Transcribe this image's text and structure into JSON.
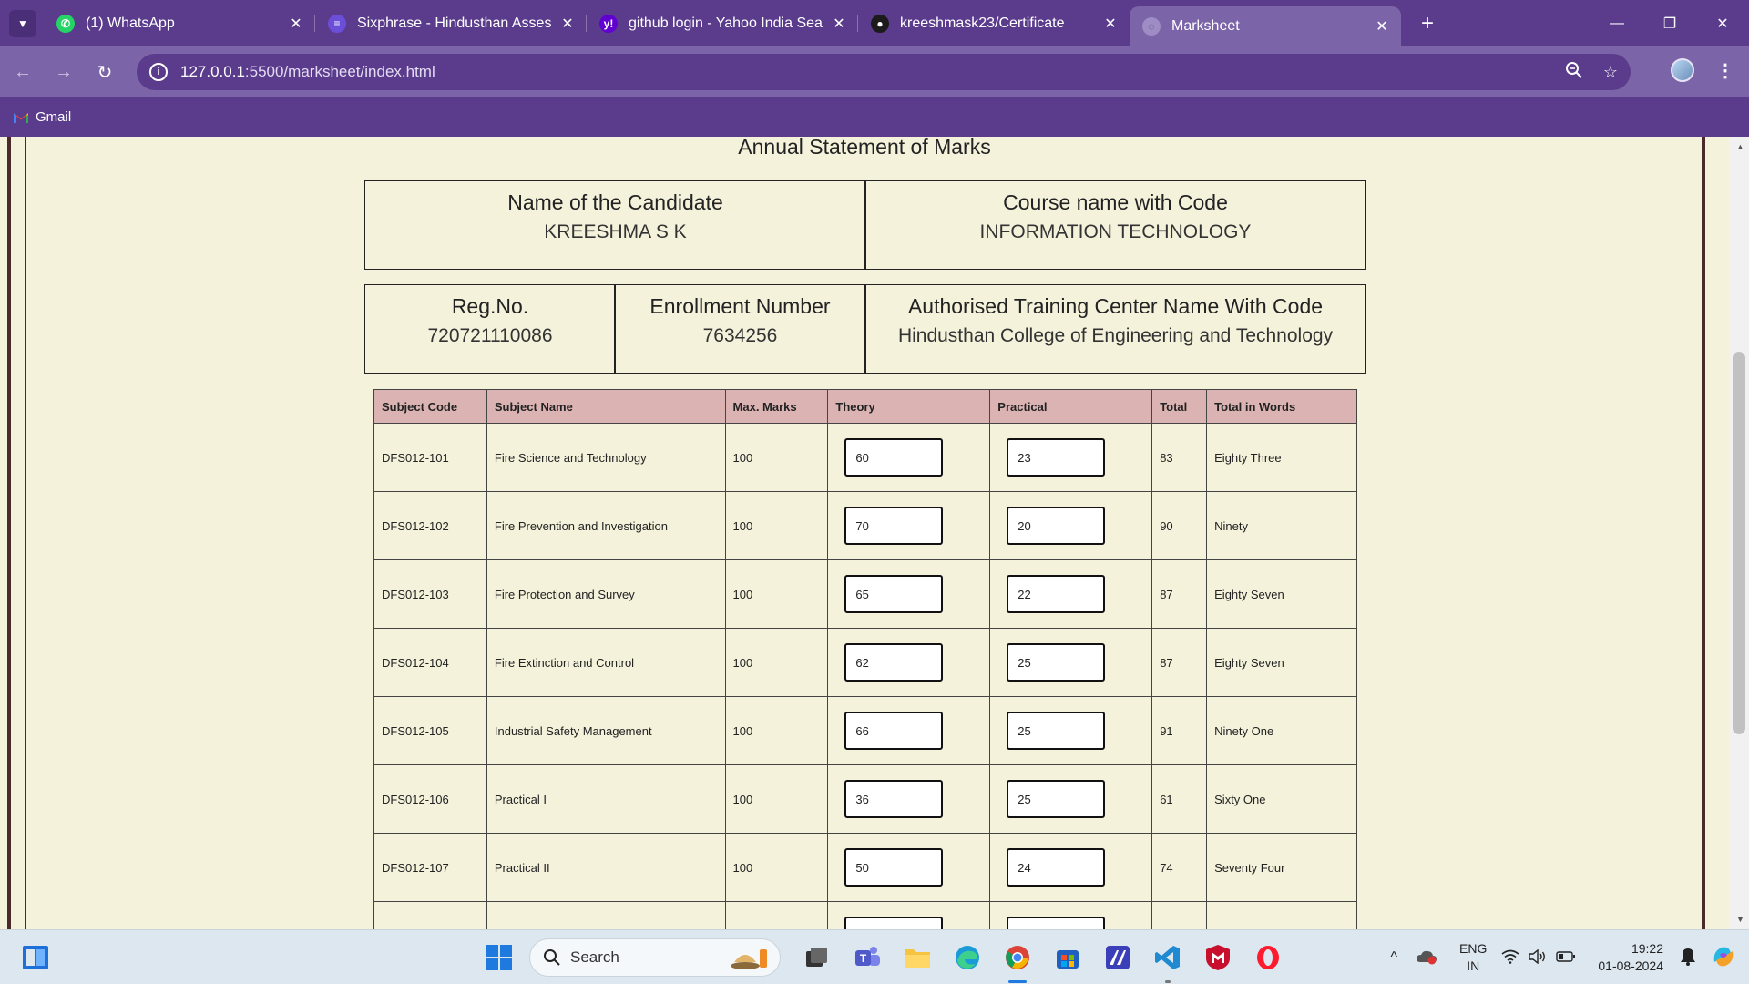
{
  "browser": {
    "tabs": [
      {
        "title": "(1) WhatsApp",
        "icon": "whatsapp-icon",
        "active": false
      },
      {
        "title": "Sixphrase - Hindusthan Assessm",
        "icon": "sixphrase-icon",
        "active": false
      },
      {
        "title": "github login - Yahoo India Sear",
        "icon": "yahoo-icon",
        "active": false
      },
      {
        "title": "kreeshmask23/Certificate",
        "icon": "github-icon",
        "active": false
      },
      {
        "title": "Marksheet",
        "icon": "globe-icon",
        "active": true
      }
    ],
    "url_host": "127.0.0.1",
    "url_path": ":5500/marksheet/index.html",
    "bookmark": "Gmail"
  },
  "page": {
    "title": "Annual Statement of Marks",
    "candidate_label": "Name of the Candidate",
    "candidate_value": "KREESHMA S K",
    "course_label": "Course name with Code",
    "course_value": "INFORMATION TECHNOLOGY",
    "reg_label": "Reg.No.",
    "reg_value": "720721110086",
    "enroll_label": "Enrollment Number",
    "enroll_value": "7634256",
    "center_label": "Authorised Training Center Name With Code",
    "center_value": "Hindusthan College of Engineering and Technology",
    "table": {
      "headers": [
        "Subject Code",
        "Subject Name",
        "Max. Marks",
        "Theory",
        "Practical",
        "Total",
        "Total in Words"
      ],
      "rows": [
        {
          "code": "DFS012-101",
          "name": "Fire Science and Technology",
          "max": "100",
          "theory": "60",
          "practical": "23",
          "total": "83",
          "words": "Eighty Three"
        },
        {
          "code": "DFS012-102",
          "name": "Fire Prevention and Investigation",
          "max": "100",
          "theory": "70",
          "practical": "20",
          "total": "90",
          "words": "Ninety"
        },
        {
          "code": "DFS012-103",
          "name": "Fire Protection and Survey",
          "max": "100",
          "theory": "65",
          "practical": "22",
          "total": "87",
          "words": "Eighty Seven"
        },
        {
          "code": "DFS012-104",
          "name": "Fire Extinction and Control",
          "max": "100",
          "theory": "62",
          "practical": "25",
          "total": "87",
          "words": "Eighty Seven"
        },
        {
          "code": "DFS012-105",
          "name": "Industrial Safety Management",
          "max": "100",
          "theory": "66",
          "practical": "25",
          "total": "91",
          "words": "Ninety One"
        },
        {
          "code": "DFS012-106",
          "name": "Practical I",
          "max": "100",
          "theory": "36",
          "practical": "25",
          "total": "61",
          "words": "Sixty One"
        },
        {
          "code": "DFS012-107",
          "name": "Practical II",
          "max": "100",
          "theory": "50",
          "practical": "24",
          "total": "74",
          "words": "Seventy Four"
        },
        {
          "code": "",
          "name": "",
          "max": "",
          "theory": "",
          "practical": "",
          "total": "",
          "words": ""
        }
      ]
    }
  },
  "taskbar": {
    "search_placeholder": "Search",
    "lang_line1": "ENG",
    "lang_line2": "IN",
    "time": "19:22",
    "date": "01-08-2024"
  },
  "colors": {
    "chrome_dark": "#5a3b8c",
    "chrome_light": "#7c64a8",
    "page_bg": "#f5f2dc",
    "table_header": "#dcb3b3"
  }
}
